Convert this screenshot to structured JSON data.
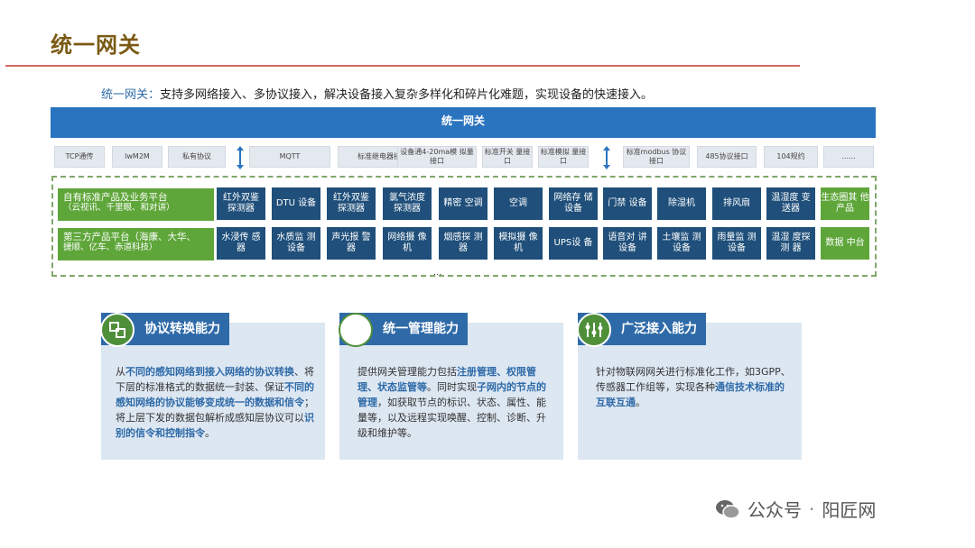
{
  "title": "统一网关",
  "intro": {
    "label": "统一网关：",
    "text": "支持多网络接入、多协议接入，解决设备接入复杂多样化和碎片化难题，实现设备的快速接入。"
  },
  "gateway_bar": "统一网关",
  "protocols": [
    "TCP通传",
    "lwM2M",
    "私有协议",
    "MQTT",
    "标准继电器接口",
    "设备通4-20ma模 拟量接口",
    "标准开关 量接口",
    "标准模拟 量接口",
    "标准modbus 协议接口",
    "485协议接口",
    "104规约",
    "......"
  ],
  "devices": {
    "own_platform": {
      "line1": "自有标准产品及业务平台",
      "line2": "（云视讯、千里眼、和对讲）"
    },
    "third_party": {
      "line1": "第三方产品平台（海康、大华、",
      "line2": "捷顺、亿车、赤道科技）"
    },
    "row1": [
      "红外双鉴 探测器",
      "DTU 设备",
      "红外双鉴 探测器",
      "氯气浓度 探测器",
      "精密 空调",
      "空调",
      "网络存 储设备",
      "门禁 设备",
      "除湿机",
      "排风扇",
      "温湿度 变送器"
    ],
    "row1_right": "生态圈其 他产品",
    "row2": [
      "水浸传 感器",
      "水质监 测设备",
      "声光报 警器",
      "网络摄 像机",
      "烟感探 测器",
      "模拟摄 像机",
      "UPS设 备",
      "语音对 讲设备",
      "土壤监 测设备",
      "雨量监 测设备",
      "温湿 度探测 器"
    ],
    "row2_right": "数据 中台",
    "ellipsis": "..."
  },
  "cards": [
    {
      "title": "协议转换能力",
      "icon": "protocol-convert-icon",
      "segments": [
        {
          "t": "从",
          "h": false
        },
        {
          "t": "不同的感知网络到接入网络的协议转换",
          "h": true
        },
        {
          "t": "、将下层的标准格式的数据统一封装、保证",
          "h": false
        },
        {
          "t": "不同的感知网络的协议能够变成统一的数据和信令",
          "h": true
        },
        {
          "t": "；将上层下发的数据包解析成感知层协议可以",
          "h": false
        },
        {
          "t": "识别的信令和控制指令",
          "h": true
        },
        {
          "t": "。",
          "h": false
        }
      ]
    },
    {
      "title": "统一管理能力",
      "icon": "management-icon",
      "segments": [
        {
          "t": "提供网关管理能力包括",
          "h": false
        },
        {
          "t": "注册管理、权限管理、状态监管等",
          "h": true
        },
        {
          "t": "。同时实现",
          "h": false
        },
        {
          "t": "子网内的节点的管理",
          "h": true
        },
        {
          "t": "，如获取节点的标识、状态、属性、能量等，以及远程实现唤醒、控制、诊断、升级和维护等。",
          "h": false
        }
      ]
    },
    {
      "title": "广泛接入能力",
      "icon": "wide-access-icon",
      "segments": [
        {
          "t": "针对物联网网关进行标准化工作，如3GPP、传感器工作组等，实现各种",
          "h": false
        },
        {
          "t": "通信技术标准的互联互通",
          "h": true
        },
        {
          "t": "。",
          "h": false
        }
      ]
    }
  ],
  "footer": {
    "prefix": "公众号",
    "separator": "·",
    "name": "阳匠网"
  },
  "colors": {
    "title": "#7a5a14",
    "blue_bar": "#2a74bf",
    "device": "#1f4f7a",
    "green": "#5fa63a",
    "card_bg": "#dde7f2",
    "highlight": "#2e6aa8"
  }
}
